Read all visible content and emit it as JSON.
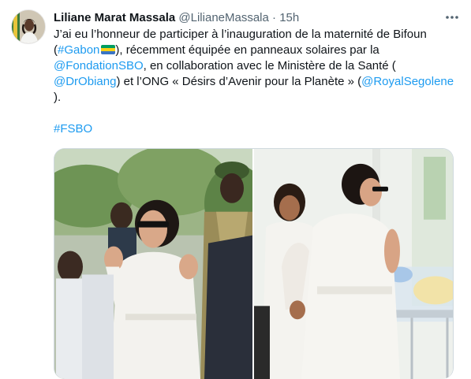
{
  "tweet": {
    "author_name": "Liliane Marat Massala",
    "author_handle": "@LilianeMassala",
    "separator": "·",
    "timestamp": "15h",
    "more_icon": "ellipsis-icon",
    "avatar_icon": "profile-photo",
    "text": {
      "line1_prefix": "J’ai eu l’honneur de participer à l’inauguration de la maternité de Bifoun",
      "open_paren": "(",
      "hashtag_gabon": "#Gabon",
      "flag_icon": "gabon-flag-emoji",
      "after_gabon": "), récemment équipée en panneaux solaires par la",
      "mention_fondation": "@FondationSBO",
      "after_fondation": ", en collaboration avec le Ministère de la Santé (",
      "mention_obiang": "@DrObiang",
      "after_obiang": ") et l’ONG « Désirs d’Avenir pour la Planète » (",
      "mention_royal": "@RoyalSegolene",
      "closing": ").",
      "hashtag_fsbo": "#FSBO"
    },
    "colors": {
      "link": "#1d9bf0",
      "text": "#0f1419",
      "secondary": "#536471",
      "flag_green": "#009e60",
      "flag_yellow": "#fcd116",
      "flag_blue": "#3a75c4"
    },
    "media": [
      {
        "name": "photo-inauguration-crowd"
      },
      {
        "name": "photo-maternity-ward-visit"
      }
    ]
  }
}
